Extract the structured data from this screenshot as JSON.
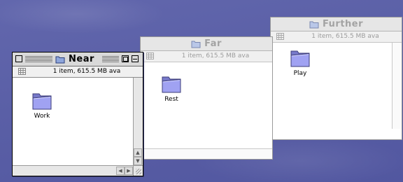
{
  "windows": {
    "near": {
      "title": "Near",
      "status": "1 item, 615.5 MB ava",
      "folder_label": "Work",
      "icons": {
        "title": "folder-icon",
        "view": "grid-icon"
      }
    },
    "far": {
      "title": "Far",
      "status": "1 item, 615.5 MB ava",
      "folder_label": "Rest",
      "icons": {
        "title": "folder-icon",
        "view": "grid-icon"
      }
    },
    "further": {
      "title": "Further",
      "status": "1 item, 615.5 MB ava",
      "folder_label": "Play",
      "icons": {
        "title": "folder-icon",
        "view": "grid-icon"
      }
    }
  },
  "colors": {
    "desktop": "#5a5fa6",
    "folder": "#9a9cf0",
    "titlebar_inactive_text": "#a3a3a3"
  }
}
